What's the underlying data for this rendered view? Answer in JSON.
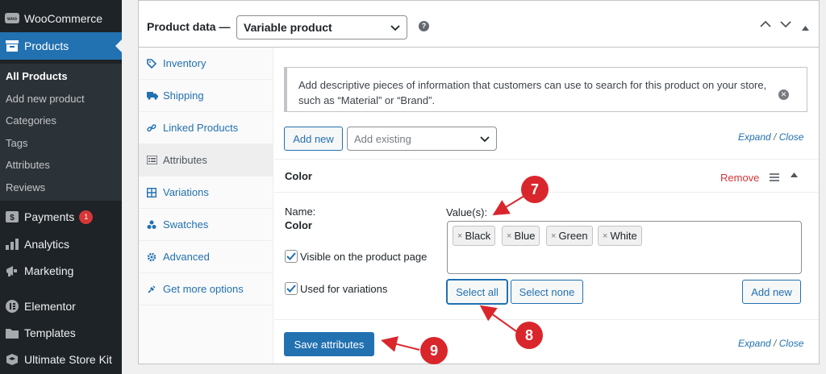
{
  "sidebar": {
    "woocommerce": "WooCommerce",
    "products": "Products",
    "submenu": [
      "All Products",
      "Add new product",
      "Categories",
      "Tags",
      "Attributes",
      "Reviews"
    ],
    "payments": "Payments",
    "payments_badge": "1",
    "analytics": "Analytics",
    "marketing": "Marketing",
    "elementor": "Elementor",
    "templates": "Templates",
    "ultimate_store_kit": "Ultimate Store Kit"
  },
  "product_data": {
    "title": "Product data —",
    "type_selected": "Variable product",
    "help": "?"
  },
  "tabs": [
    "Inventory",
    "Shipping",
    "Linked Products",
    "Attributes",
    "Variations",
    "Swatches",
    "Advanced",
    "Get more options"
  ],
  "attributes_panel": {
    "notice": "Add descriptive pieces of information that customers can use to search for this product on your store, such as “Material” or “Brand”.",
    "add_new": "Add new",
    "add_existing_placeholder": "Add existing",
    "expand": "Expand",
    "separator": "/",
    "close": "Close",
    "attribute": {
      "header_name": "Color",
      "remove": "Remove",
      "name_label": "Name:",
      "name_value": "Color",
      "values_label": "Value(s):",
      "values": [
        "Black",
        "Blue",
        "Green",
        "White"
      ],
      "visible_label": "Visible on the product page",
      "variations_label": "Used for variations",
      "select_all": "Select all",
      "select_none": "Select none",
      "add_new_value": "Add new"
    },
    "save": "Save attributes"
  },
  "callouts": [
    "7",
    "8",
    "9"
  ],
  "colors": {
    "accent": "#2271b1",
    "sidebar_bg": "#1d2327",
    "danger": "#d63638",
    "callout": "#d9262c"
  }
}
